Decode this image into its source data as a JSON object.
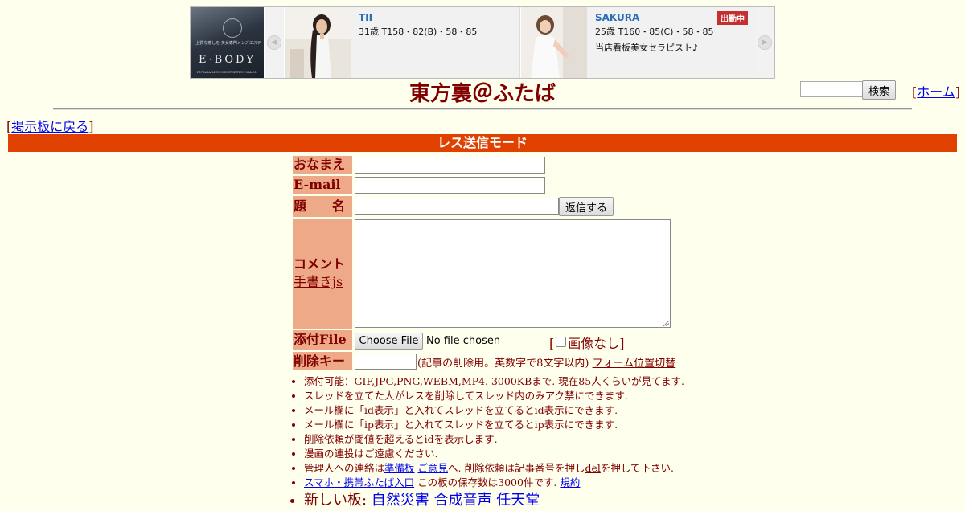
{
  "banner": {
    "logo": {
      "small_text": "上質な癒しを 美女専門メンズエステ",
      "brand": "E·BODY",
      "tagline": "FUTABA MEN'S ESTHETICS SALON"
    },
    "cards": [
      {
        "name": "TII",
        "spec": "31歳 T158・82(B)・58・85",
        "message": "",
        "badge": ""
      },
      {
        "name": "SAKURA",
        "spec": "25歳 T160・85(C)・58・85",
        "message": "当店看板美女セラピスト♪",
        "badge": "出勤中"
      }
    ],
    "prev_icon": "◀",
    "next_icon": "▶"
  },
  "header": {
    "title": "東方裏＠ふたば",
    "search_button": "検索",
    "home_link": "ホーム",
    "back_link": "掲示板に戻る"
  },
  "mode_bar": "レス送信モード",
  "form": {
    "name_label": "おなまえ",
    "email_label": "E-mail",
    "subject_label": "題　　名",
    "submit_button": "返信する",
    "comment_label": "コメント",
    "handwrite_link": "手書きjs",
    "file_label": "添付File",
    "choose_file_button": "Choose File",
    "file_status": "No file chosen",
    "no_image_label": "画像なし",
    "delete_key_label": "削除キー",
    "delete_key_note": "(記事の削除用。英数字で8文字以内)",
    "form_position_link": "フォーム位置切替"
  },
  "notes": {
    "line1": "添付可能：GIF,JPG,PNG,WEBM,MP4. 3000KBまで. 現在85人くらいが見てます.",
    "line2": "スレッドを立てた人がレスを削除してスレッド内のみアク禁にできます.",
    "line3": "メール欄に「id表示」と入れてスレッドを立てるとid表示にできます.",
    "line4": "メール欄に「ip表示」と入れてスレッドを立てるとip表示にできます.",
    "line5": "削除依頼が閾値を超えるとidを表示します.",
    "line6": "漫画の連投はご遠慮ください.",
    "line7_pre": "管理人への連絡は",
    "line7_link1": "準備板",
    "line7_link2": "ご意見",
    "line7_mid": "へ. 削除依頼は記事番号を押し",
    "line7_link3": "del",
    "line7_post": "を押して下さい.",
    "line8_link": "スマホ・携帯ふたば入口",
    "line8_mid": " この板の保存数は3000件です. ",
    "line8_link2": "規約",
    "line9_pre": "新しい板: ",
    "line9_links": [
      "自然災害",
      "合成音声",
      "任天堂"
    ]
  }
}
